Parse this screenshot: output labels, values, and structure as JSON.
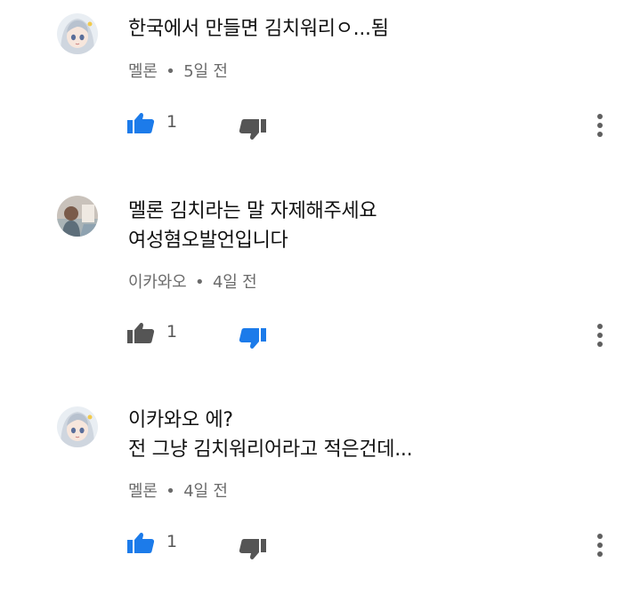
{
  "colors": {
    "active_blue": "#1c7bea",
    "inactive_gray": "#555555",
    "meta_gray": "#6b6b6b"
  },
  "comments": [
    {
      "author": "멜론",
      "time": "5일 전",
      "separator": "•",
      "text": "한국에서 만들면 김치워리ㅇ...됨",
      "like_count": "1",
      "liked": true,
      "disliked": false,
      "avatar_icon": "anime-girl-avatar",
      "more_icon": "more-vert-icon"
    },
    {
      "author": "이카와오",
      "time": "4일 전",
      "separator": "•",
      "text": "멜론 김치라는 말 자제해주세요\n여성혐오발언입니다",
      "like_count": "1",
      "liked": false,
      "disliked": true,
      "avatar_icon": "photo-avatar",
      "more_icon": "more-vert-icon"
    },
    {
      "author": "멜론",
      "time": "4일 전",
      "separator": "•",
      "text": "이카와오 에?\n전 그냥 김치워리어라고 적은건데...",
      "like_count": "1",
      "liked": true,
      "disliked": false,
      "avatar_icon": "anime-girl-avatar",
      "more_icon": "more-vert-icon"
    }
  ]
}
